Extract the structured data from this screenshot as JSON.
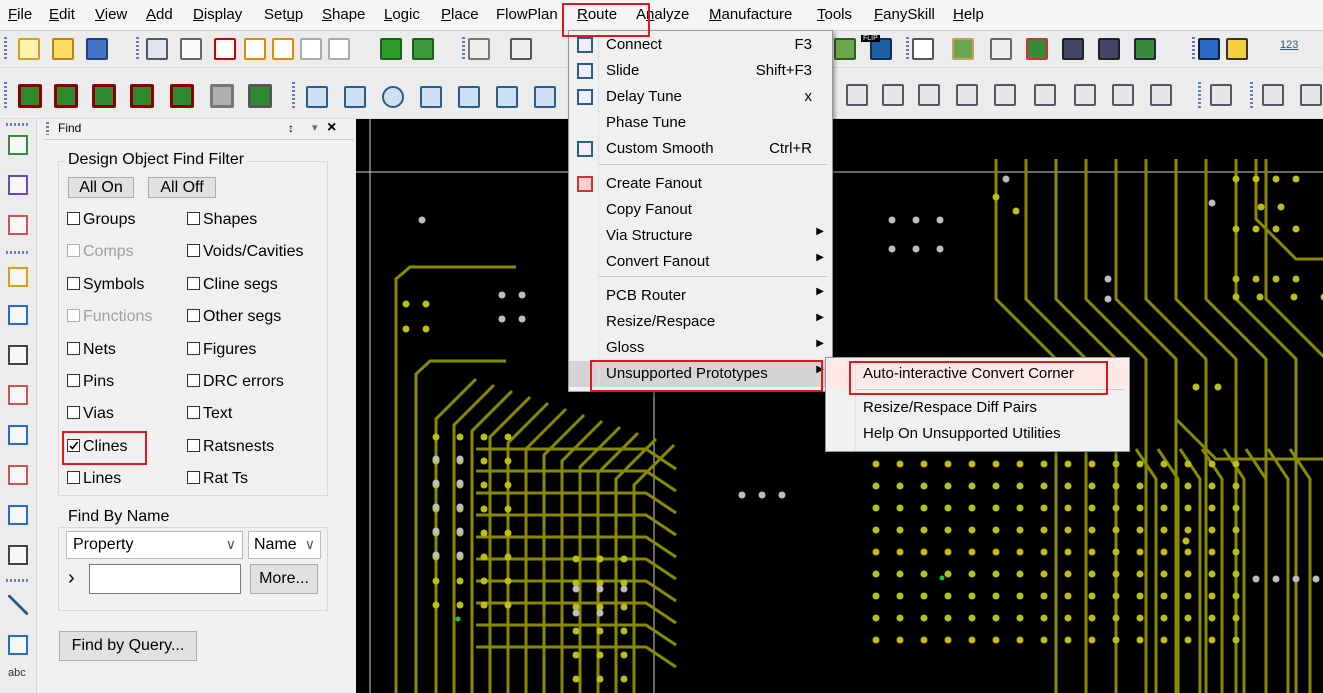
{
  "menubar": {
    "items": [
      {
        "label": "File",
        "acc": "F"
      },
      {
        "label": "Edit",
        "acc": "E"
      },
      {
        "label": "View",
        "acc": "V"
      },
      {
        "label": "Add",
        "acc": "A"
      },
      {
        "label": "Display",
        "acc": "D"
      },
      {
        "label": "Setup",
        "acc": "u"
      },
      {
        "label": "Shape",
        "acc": "S"
      },
      {
        "label": "Logic",
        "acc": "L"
      },
      {
        "label": "Place",
        "acc": "P"
      },
      {
        "label": "FlowPlan",
        "acc": ""
      },
      {
        "label": "Route",
        "acc": "R"
      },
      {
        "label": "Analyze",
        "acc": "n"
      },
      {
        "label": "Manufacture",
        "acc": "M"
      },
      {
        "label": "Tools",
        "acc": "T"
      },
      {
        "label": "FanySkill",
        "acc": "F"
      },
      {
        "label": "Help",
        "acc": "H"
      }
    ]
  },
  "find_panel": {
    "title": "Find",
    "pin_symbol": "↕",
    "dropdown_symbol": "▾",
    "close_symbol": "×",
    "filter_group_title": "Design Object Find Filter",
    "all_on_label": "All On",
    "all_off_label": "All Off",
    "checkboxes": [
      {
        "label": "Groups",
        "checked": false,
        "disabled": false
      },
      {
        "label": "Shapes",
        "checked": false,
        "disabled": false
      },
      {
        "label": "Comps",
        "checked": false,
        "disabled": true
      },
      {
        "label": "Voids/Cavities",
        "checked": false,
        "disabled": false
      },
      {
        "label": "Symbols",
        "checked": false,
        "disabled": false
      },
      {
        "label": "Cline segs",
        "checked": false,
        "disabled": false
      },
      {
        "label": "Functions",
        "checked": false,
        "disabled": true
      },
      {
        "label": "Other segs",
        "checked": false,
        "disabled": false
      },
      {
        "label": "Nets",
        "checked": false,
        "disabled": false
      },
      {
        "label": "Figures",
        "checked": false,
        "disabled": false
      },
      {
        "label": "Pins",
        "checked": false,
        "disabled": false
      },
      {
        "label": "DRC errors",
        "checked": false,
        "disabled": false
      },
      {
        "label": "Vias",
        "checked": false,
        "disabled": false
      },
      {
        "label": "Text",
        "checked": false,
        "disabled": false
      },
      {
        "label": "Clines",
        "checked": true,
        "disabled": false
      },
      {
        "label": "Ratsnests",
        "checked": false,
        "disabled": false
      },
      {
        "label": "Lines",
        "checked": false,
        "disabled": false
      },
      {
        "label": "Rat Ts",
        "checked": false,
        "disabled": false
      }
    ],
    "find_by_name_title": "Find By Name",
    "property_select_value": "Property",
    "name_select_value": "Name",
    "chevron_symbol": "∨",
    "expand_symbol": "›",
    "name_input_value": "",
    "more_button_label": "More...",
    "find_by_query_label": "Find by Query..."
  },
  "route_menu": {
    "items": [
      {
        "label": "Connect",
        "shortcut": "F3",
        "submenu": false,
        "icon": "connect-icon"
      },
      {
        "label": "Slide",
        "shortcut": "Shift+F3",
        "submenu": false,
        "icon": "slide-icon"
      },
      {
        "label": "Delay Tune",
        "shortcut": "x",
        "submenu": false,
        "icon": "delay-tune-icon"
      },
      {
        "label": "Phase Tune",
        "shortcut": "",
        "submenu": false,
        "icon": ""
      },
      {
        "label": "Custom Smooth",
        "shortcut": "Ctrl+R",
        "submenu": false,
        "icon": "custom-smooth-icon"
      },
      {
        "label": "Create Fanout",
        "shortcut": "",
        "submenu": false,
        "icon": "create-fanout-icon"
      },
      {
        "label": "Copy Fanout",
        "shortcut": "",
        "submenu": false,
        "icon": ""
      },
      {
        "label": "Via Structure",
        "shortcut": "",
        "submenu": true,
        "icon": ""
      },
      {
        "label": "Convert Fanout",
        "shortcut": "",
        "submenu": true,
        "icon": ""
      },
      {
        "label": "PCB Router",
        "shortcut": "",
        "submenu": true,
        "icon": ""
      },
      {
        "label": "Resize/Respace",
        "shortcut": "",
        "submenu": true,
        "icon": ""
      },
      {
        "label": "Gloss",
        "shortcut": "",
        "submenu": true,
        "icon": ""
      },
      {
        "label": "Unsupported Prototypes",
        "shortcut": "",
        "submenu": true,
        "icon": ""
      }
    ],
    "submenu_arrow": "▶"
  },
  "unsupported_submenu": {
    "items": [
      {
        "label": "Auto-interactive Convert Corner"
      },
      {
        "label": "Resize/Respace Diff Pairs"
      },
      {
        "label": "Help On Unsupported Utilities"
      }
    ]
  },
  "left_strip": {
    "icons": [
      "component-icon",
      "u1-icon",
      "pad-icon",
      "route-icon",
      "stretch-icon",
      "delay-tune-icon",
      "smooth-icon",
      "arrow-icon",
      "list-icon",
      "grid-icon",
      "tune-icon",
      "line-icon",
      "rectangle-icon",
      "add-text-icon"
    ],
    "abc_label": "abc"
  },
  "toolbar1": {
    "label_123": "123",
    "flip_label": "FLIP"
  },
  "colors": {
    "canvas_bg": "#000000",
    "trace": "#8a8a00",
    "pad": "#bcbc1a",
    "via": "#bdbdbd",
    "highlight_red": "#e0171e",
    "menu_hover": "#d4d4d4"
  }
}
